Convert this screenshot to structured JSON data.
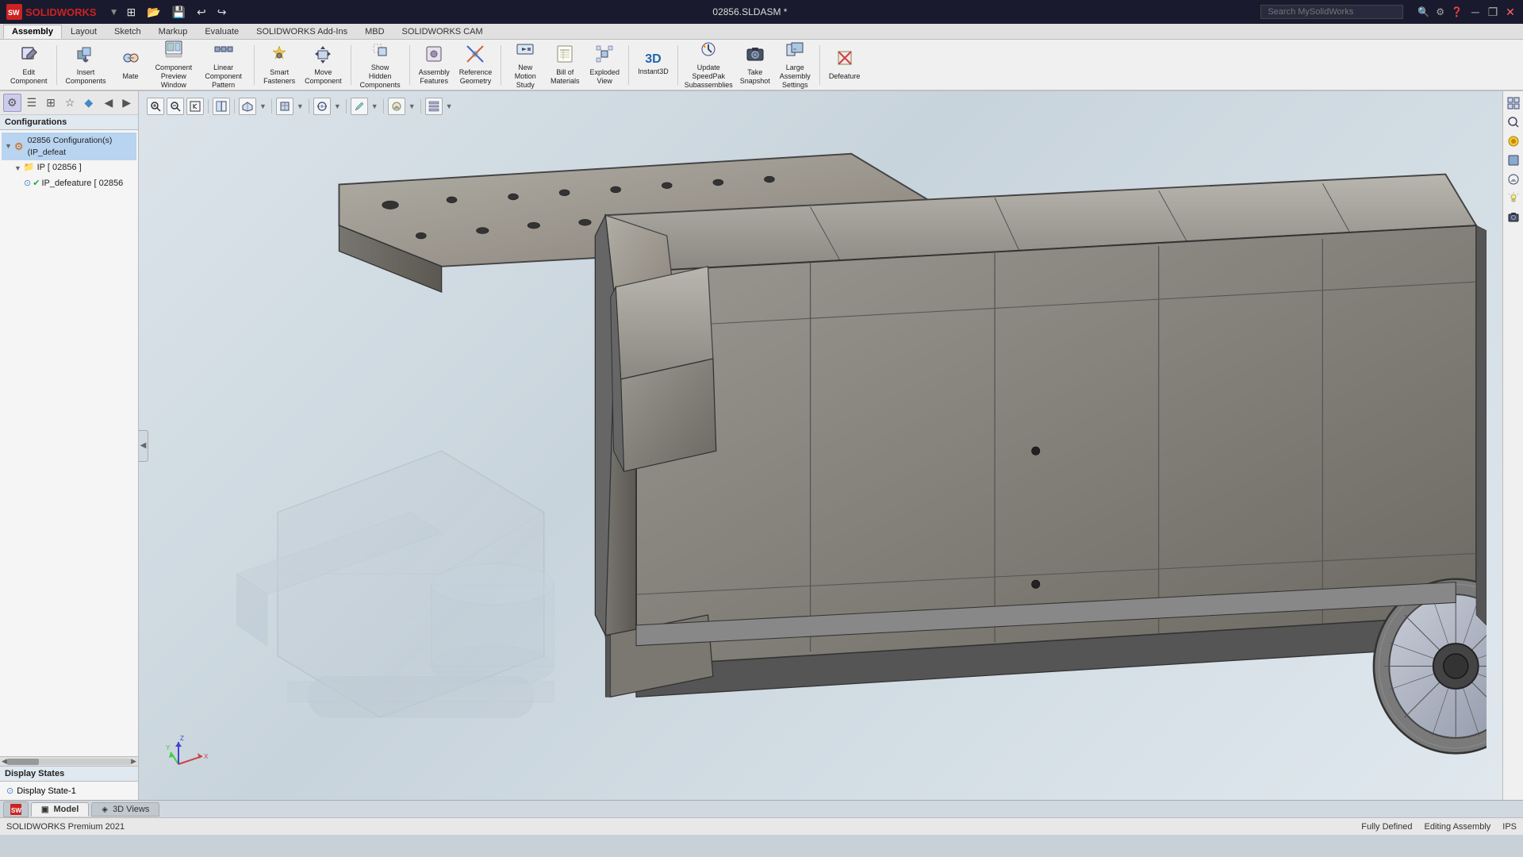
{
  "titlebar": {
    "title": "02856.SLDASM *",
    "search_placeholder": "Search MySolidWorks",
    "logo_text": "SOLIDWORKS"
  },
  "qat": {
    "buttons": [
      "⊞",
      "↩",
      "↪",
      "💾",
      "▼",
      "◀",
      "▶"
    ]
  },
  "ribbon": {
    "tabs": [
      {
        "label": "Assembly",
        "active": true
      },
      {
        "label": "Layout",
        "active": false
      },
      {
        "label": "Sketch",
        "active": false
      },
      {
        "label": "Markup",
        "active": false
      },
      {
        "label": "Evaluate",
        "active": false
      },
      {
        "label": "SOLIDWORKS Add-Ins",
        "active": false
      },
      {
        "label": "MBD",
        "active": false
      },
      {
        "label": "SOLIDWORKS CAM",
        "active": false
      }
    ],
    "buttons": [
      {
        "icon": "✏️",
        "label": "Edit\nComponent",
        "name": "edit-component"
      },
      {
        "icon": "⊕",
        "label": "Insert\nComponents",
        "name": "insert-components"
      },
      {
        "icon": "🔗",
        "label": "Mate",
        "name": "mate"
      },
      {
        "icon": "🪟",
        "label": "Component\nPreview\nWindow",
        "name": "component-preview-window"
      },
      {
        "icon": "⊞",
        "label": "Linear Component\nPattern",
        "name": "linear-component-pattern"
      },
      {
        "icon": "🔩",
        "label": "Smart\nFasteners",
        "name": "smart-fasteners"
      },
      {
        "icon": "↔",
        "label": "Move\nComponent",
        "name": "move-component"
      },
      {
        "icon": "👁",
        "label": "Show\nHidden\nComponents",
        "name": "show-hidden-components"
      },
      {
        "icon": "🔧",
        "label": "Assembly\nFeatures",
        "name": "assembly-features"
      },
      {
        "icon": "📐",
        "label": "Reference\nGeometry",
        "name": "reference-geometry"
      },
      {
        "icon": "🎬",
        "label": "New\nMotion\nStudy",
        "name": "new-motion-study"
      },
      {
        "icon": "📋",
        "label": "Bill of\nMaterials",
        "name": "bill-of-materials"
      },
      {
        "icon": "💥",
        "label": "Exploded\nView",
        "name": "exploded-view"
      },
      {
        "icon": "3D",
        "label": "Instant3D",
        "name": "instant3d"
      },
      {
        "icon": "🔄",
        "label": "Update\nSpeedPak\nSubassemblies",
        "name": "update-speedpak"
      },
      {
        "icon": "📷",
        "label": "Take\nSnapshot",
        "name": "take-snapshot"
      },
      {
        "icon": "🏗",
        "label": "Large\nAssembly\nSettings",
        "name": "large-assembly-settings"
      },
      {
        "icon": "❌",
        "label": "Defeature",
        "name": "defeature"
      }
    ]
  },
  "left_panel": {
    "panel_icons": [
      "▣",
      "☰",
      "⊞",
      "☆",
      "🔷",
      "◀",
      "▶"
    ],
    "configurations_header": "Configurations",
    "tree": [
      {
        "level": 0,
        "icon": "⚙",
        "label": "02856 Configuration(s) (IP_defeat",
        "expanded": true,
        "selected": true
      },
      {
        "level": 1,
        "icon": "📁",
        "label": "IP [ 02856 ]",
        "expanded": true,
        "selected": false
      },
      {
        "level": 2,
        "icon": "✔",
        "label": "IP_defeature [ 02856",
        "selected": false
      }
    ],
    "display_states_header": "Display States",
    "display_states": [
      {
        "icon": "⊙",
        "label": "Display State-1"
      }
    ]
  },
  "view_toolbar": {
    "buttons": [
      {
        "icon": "🔍",
        "title": "Zoom to Fit",
        "name": "zoom-fit"
      },
      {
        "icon": "🔎",
        "title": "Zoom to Area",
        "name": "zoom-area"
      },
      {
        "icon": "◫",
        "title": "Previous View",
        "name": "prev-view"
      },
      {
        "icon": "⊡",
        "title": "Section View",
        "name": "section-view"
      },
      {
        "icon": "🔲",
        "title": "View Orientation",
        "name": "view-orientation"
      },
      {
        "icon": "◻",
        "title": "Display Style",
        "name": "display-style"
      },
      {
        "icon": "◈",
        "title": "Hide/Show Items",
        "name": "hide-show-items"
      },
      {
        "icon": "⬦",
        "title": "Edit Appearance",
        "name": "edit-appearance"
      },
      {
        "icon": "◉",
        "title": "Apply Scene",
        "name": "apply-scene"
      },
      {
        "icon": "🖥",
        "title": "View Setting",
        "name": "view-setting"
      }
    ]
  },
  "right_toolbar": {
    "buttons": [
      {
        "icon": "🔲",
        "name": "rt-btn-1"
      },
      {
        "icon": "📌",
        "name": "rt-btn-2"
      },
      {
        "icon": "🎨",
        "name": "rt-btn-3"
      },
      {
        "icon": "🔵",
        "name": "rt-btn-4"
      },
      {
        "icon": "◉",
        "name": "rt-btn-5"
      },
      {
        "icon": "⬜",
        "name": "rt-btn-6"
      },
      {
        "icon": "🔳",
        "name": "rt-btn-7"
      }
    ]
  },
  "statusbar": {
    "left": "SOLIDWORKS Premium 2021",
    "status1": "Fully Defined",
    "status2": "Editing Assembly",
    "units": "IPS"
  },
  "bottom_tabs": [
    {
      "label": "Model",
      "active": true
    },
    {
      "label": "3D Views",
      "active": false
    }
  ],
  "colors": {
    "viewport_bg_start": "#dce4ea",
    "viewport_bg_end": "#c8d4dc",
    "model_dark": "#7a7a72",
    "model_light": "#b0b0a8",
    "model_mid": "#908e88"
  }
}
